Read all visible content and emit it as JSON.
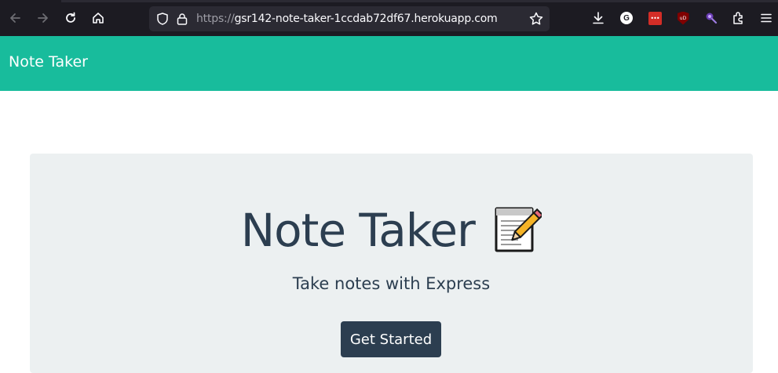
{
  "browser": {
    "url_scheme": "https://",
    "url_host": "gsr142-note-taker-1ccdab72df67.herokuapp.com",
    "icons": [
      "back-icon",
      "forward-icon",
      "reload-icon",
      "home-icon",
      "shield-icon",
      "lock-icon",
      "bookmark-star-icon",
      "download-icon",
      "grammarly-extension-icon",
      "lastpass-extension-icon",
      "ublock-extension-icon",
      "puzzle-extension-icon",
      "extensions-icon",
      "menu-icon"
    ],
    "grammarly_letter": "G",
    "lastpass_label": "•••",
    "ublock_label": "uD"
  },
  "navbar": {
    "brand": "Note Taker",
    "color": "#18bc9c"
  },
  "hero": {
    "title": "Note Taker",
    "emoji_icon": "memo-icon",
    "lead": "Take notes with Express",
    "button_label": "Get Started",
    "background": "#ecf0f1",
    "text_color": "#2c3e50"
  }
}
